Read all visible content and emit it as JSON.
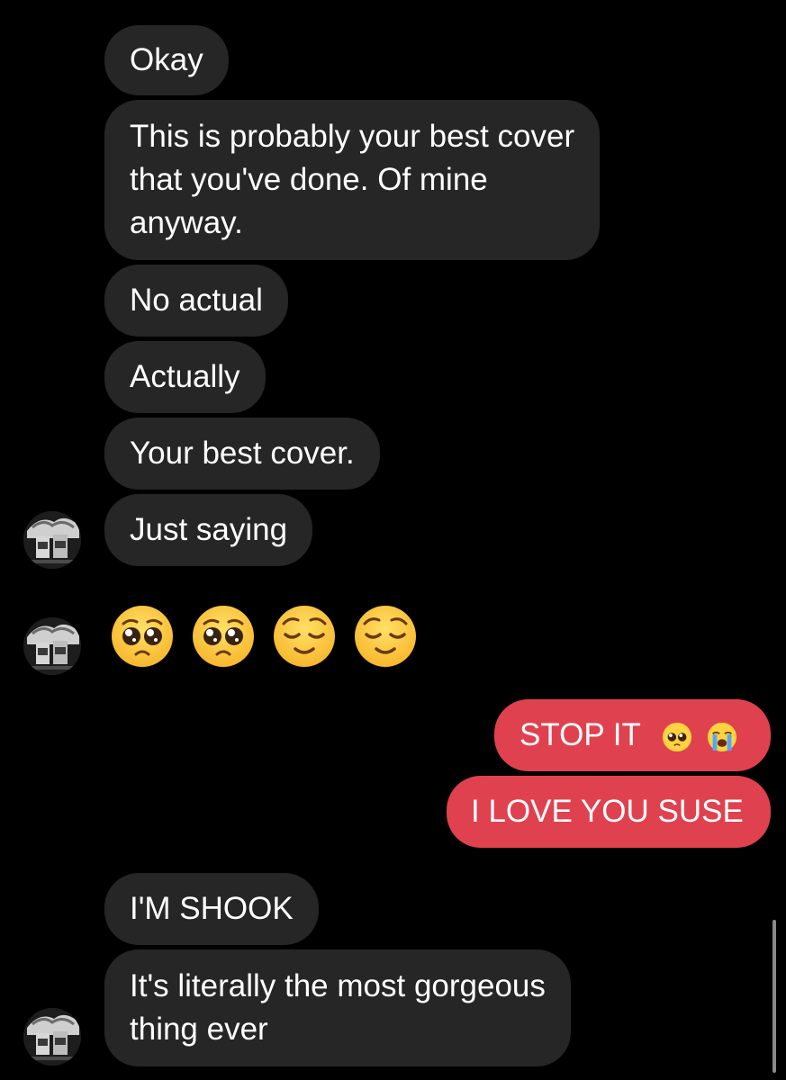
{
  "conversation": {
    "received": [
      {
        "lines": [
          "Okay"
        ]
      },
      {
        "lines": [
          "This is probably your best cover",
          "that you've done. Of mine",
          "anyway."
        ]
      },
      {
        "lines": [
          "No actual"
        ]
      },
      {
        "lines": [
          "Actually"
        ]
      },
      {
        "lines": [
          "Your best cover."
        ]
      },
      {
        "lines": [
          "Just saying"
        ]
      },
      {
        "lines": [
          "I'M SHOOK"
        ]
      },
      {
        "lines": [
          "It's literally the most gorgeous",
          "thing ever"
        ]
      }
    ],
    "sent": [
      {
        "text": "STOP IT"
      },
      {
        "text": "I LOVE YOU SUSE"
      }
    ],
    "emoji_message": [
      "pleading-face-icon",
      "pleading-face-icon",
      "relieved-face-icon",
      "relieved-face-icon"
    ],
    "sent_emojis": [
      "pleading-face-icon",
      "loudly-crying-face-icon"
    ]
  },
  "colors": {
    "background": "#000000",
    "received_bubble": "#262626",
    "sent_bubble": "#e0414f",
    "text": "#ffffff"
  }
}
